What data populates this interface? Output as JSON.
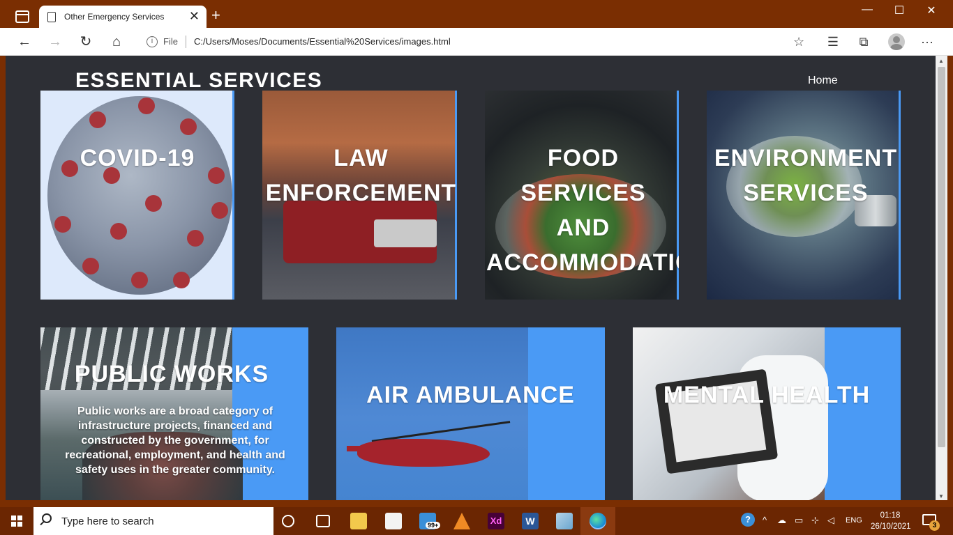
{
  "browser": {
    "tab_title": "Other Emergency Services",
    "file_label": "File",
    "url": "C:/Users/Moses/Documents/Essential%20Services/images.html",
    "icons": {
      "sidebar": "tab-actions-icon",
      "back": "back-arrow-icon",
      "forward": "forward-arrow-icon",
      "refresh": "refresh-icon",
      "home": "home-icon",
      "info": "info-icon",
      "add_favorite": "star-plus-icon",
      "favorites": "favorites-icon",
      "collections": "collections-icon",
      "profile": "profile-avatar-icon",
      "menu": "more-menu-icon"
    }
  },
  "page": {
    "site_title": "ESSENTIAL SERVICES",
    "nav_home": "Home",
    "cards": [
      {
        "heading_lines": [
          "COVID-19"
        ]
      },
      {
        "heading_lines": [
          "LAW",
          "ENFORCEMENT"
        ]
      },
      {
        "heading_lines": [
          "FOOD",
          "SERVICES",
          "AND",
          "ACCOMMODATION"
        ]
      },
      {
        "heading_lines": [
          "ENVIRONMENT",
          "SERVICES"
        ]
      },
      {
        "heading_lines": [
          "PUBLIC WORKS"
        ],
        "description": "Public works are a broad category of infrastructure projects, financed and constructed by the government, for recreational, employment, and health and safety uses in the greater community."
      },
      {
        "heading_lines": [
          "AIR AMBULANCE"
        ]
      },
      {
        "heading_lines": [
          "MENTAL HEALTH"
        ]
      }
    ],
    "accent_color": "#4a9af5",
    "background_color": "#2d2f35"
  },
  "taskbar": {
    "search_placeholder": "Type here to search",
    "mail_badge": "99+",
    "xd_label": "Xd",
    "word_label": "W",
    "language": "ENG",
    "time": "01:18",
    "date": "26/10/2021",
    "notification_count": "3"
  }
}
